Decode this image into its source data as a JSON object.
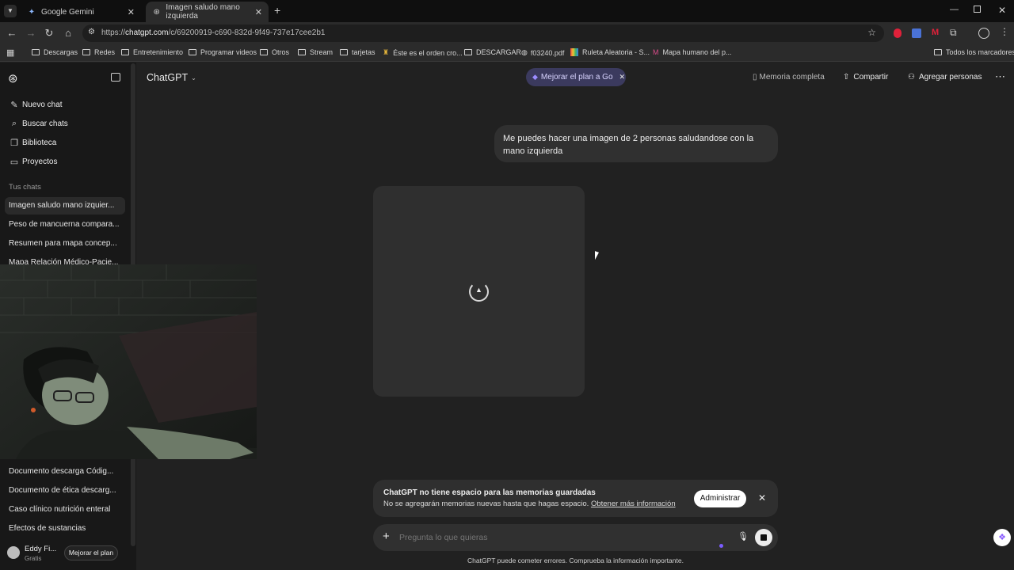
{
  "browser": {
    "tabs": [
      {
        "title": "Google Gemini",
        "active": false
      },
      {
        "title": "Imagen saludo mano izquierda",
        "active": true
      }
    ],
    "url_prefix": "https://",
    "url_domain": "chatgpt.com",
    "url_path": "/c/69200919-c690-832d-9f49-737e17cee2b1",
    "bookmarks": [
      "Descargas",
      "Redes",
      "Entretenimiento",
      "Programar videos",
      "Otros",
      "Stream",
      "tarjetas",
      "Éste es el orden cro...",
      "DESCARGAR",
      "f03240.pdf",
      "Ruleta Aleatoria - S...",
      "Mapa humano del p..."
    ],
    "all_bookmarks": "Todos los marcadores"
  },
  "sidebar": {
    "nav": [
      {
        "label": "Nuevo chat",
        "icon": "edit-icon"
      },
      {
        "label": "Buscar chats",
        "icon": "search-icon"
      },
      {
        "label": "Biblioteca",
        "icon": "library-icon"
      },
      {
        "label": "Proyectos",
        "icon": "folder-icon"
      }
    ],
    "section_label": "Tus chats",
    "chats_top": [
      "Imagen saludo mano izquier...",
      "Peso de mancuerna compara...",
      "Resumen para mapa concep...",
      "Mapa Relación Médico-Pacie..."
    ],
    "chats_bottom": [
      "Documento descarga Códig...",
      "Documento de ética descarg...",
      "Caso clínico nutrición enteral",
      "Efectos de sustancias"
    ],
    "user": {
      "name": "Eddy Fi...",
      "plan": "Gratis",
      "upgrade_label": "Mejorar el plan"
    }
  },
  "header": {
    "model": "ChatGPT",
    "upgrade_pill": "Mejorar el plan a Go",
    "memory": "Memoria completa",
    "share": "Compartir",
    "add_people": "Agregar personas"
  },
  "conversation": {
    "user_message": "Me puedes hacer una imagen de 2 personas saludandose con la mano izquierda"
  },
  "notice": {
    "title": "ChatGPT no tiene espacio para las memorias guardadas",
    "body": "No se agregarán memorias nuevas hasta que hagas espacio.",
    "link": "Obtener más información",
    "button": "Administrar"
  },
  "composer": {
    "placeholder": "Pregunta lo que quieras"
  },
  "footer": "ChatGPT puede cometer errores. Comprueba la información importante.",
  "colors": {
    "accent_purple": "#3b3a5e",
    "pill_text": "#d8d4ff",
    "brand_red": "#e0213a"
  }
}
